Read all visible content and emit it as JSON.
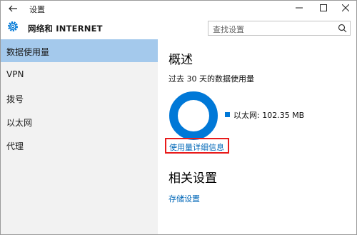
{
  "titlebar": {
    "title": "设置"
  },
  "header": {
    "section_title": "网络和 INTERNET"
  },
  "search": {
    "placeholder": "查找设置"
  },
  "sidebar": {
    "items": [
      {
        "label": "数据使用量",
        "active": true
      },
      {
        "label": "VPN"
      },
      {
        "label": "拨号"
      },
      {
        "label": "以太网"
      },
      {
        "label": "代理"
      }
    ]
  },
  "main": {
    "overview_heading": "概述",
    "period_text": "过去 30 天的数据使用量",
    "legend_entry": "以太网: 102.35 MB",
    "usage_fraction_ethernet": 1.0,
    "details_link": "使用量详细信息",
    "related_heading": "相关设置",
    "storage_link": "存储设置"
  },
  "colors": {
    "accent": "#0078d7",
    "sidebar_active": "#a4c9ec",
    "link": "#0067b8",
    "highlight_box": "#e81b1b"
  }
}
